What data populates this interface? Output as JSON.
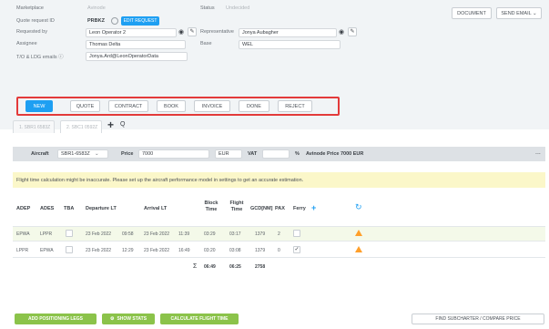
{
  "header": {
    "marketplace_label": "Marketplace",
    "marketplace_value": "Avinode",
    "status_label": "Status",
    "status_value": "Undecided",
    "quote_request_label": "Quote request ID",
    "quote_request_value": "PRBKZ",
    "edit_request_label": "EDIT REQUEST",
    "requested_by_label": "Requested by",
    "requested_by_value": "Leon Operator 2",
    "representative_label": "Representative",
    "representative_value": "Jonya Aubagher",
    "assignee_label": "Assignee",
    "assignee_value": "Thomas Delta",
    "base_label": "Base",
    "base_value": "WEL",
    "toc_label": "T/O & LDG emails ⓘ",
    "toc_value": "Jonya.Ard@LeonOperatorData",
    "document_button": "DOCUMENT",
    "send_email_button": "SEND EMAIL ⌄"
  },
  "status_buttons": [
    "NEW",
    "QUOTE",
    "CONTRACT",
    "BOOK",
    "INVOICE",
    "DONE",
    "REJECT"
  ],
  "option_tabs": [
    {
      "label": "1. SBR1 6583Z"
    },
    {
      "label": "2. SBC1 0592Z"
    }
  ],
  "add_tab_label": "+",
  "search_tab_label": "Q",
  "aircraft": {
    "aircraft_label": "Aircraft",
    "aircraft_value": "SBR1-6583Z",
    "price_label": "Price",
    "price_value": "7000",
    "currency_value": "EUR",
    "vat_label": "VAT",
    "vat_value": "",
    "percent_label": "%",
    "avinode_price_label": "Avinode Price",
    "avinode_price_value": "7000 EUR",
    "more_label": "..."
  },
  "warning_text": "Flight time calculation might be inaccurate. Please set up the aircraft performance model in settings to get an accurate estimation.",
  "table": {
    "headers": [
      "ADEP",
      "ADES",
      "TBA",
      "Departure LT",
      "Arrival LT",
      "Block Time",
      "Flight Time",
      "GCD[NM]",
      "PAX",
      "Ferry"
    ],
    "rows": [
      {
        "adep": "EPWA",
        "ades": "LPPR",
        "dep_date": "23 Feb 2022",
        "dep_time": "09:58",
        "arr_date": "23 Feb 2022",
        "arr_time": "11:39",
        "block": "03:29",
        "flight": "03:17",
        "gcd": "1379",
        "pax": "2",
        "ferry": false
      },
      {
        "adep": "LPPR",
        "ades": "EPWA",
        "dep_date": "23 Feb 2022",
        "dep_time": "12:29",
        "arr_date": "23 Feb 2022",
        "arr_time": "16:49",
        "block": "03:20",
        "flight": "03:08",
        "gcd": "1379",
        "pax": "0",
        "ferry": true
      }
    ],
    "totals": {
      "sum_symbol": "Σ",
      "block": "06:49",
      "flight": "06:25",
      "gcd": "2758"
    }
  },
  "footer": {
    "add_positioning_button": "ADD POSITIONING LEGS",
    "show_stats_button": "SHOW STATS",
    "calculate_button": "CALCULATE FLIGHT TIME",
    "find_subcharter_button": "FIND SUBCHARTER / COMPARE PRICE"
  },
  "colors": {
    "accent_blue": "#1e9ff2",
    "accent_green": "#8bc34a",
    "highlight_red": "#e33a3a",
    "warning_bg": "#fbf7c9",
    "alert_orange": "#ff9f2a"
  }
}
